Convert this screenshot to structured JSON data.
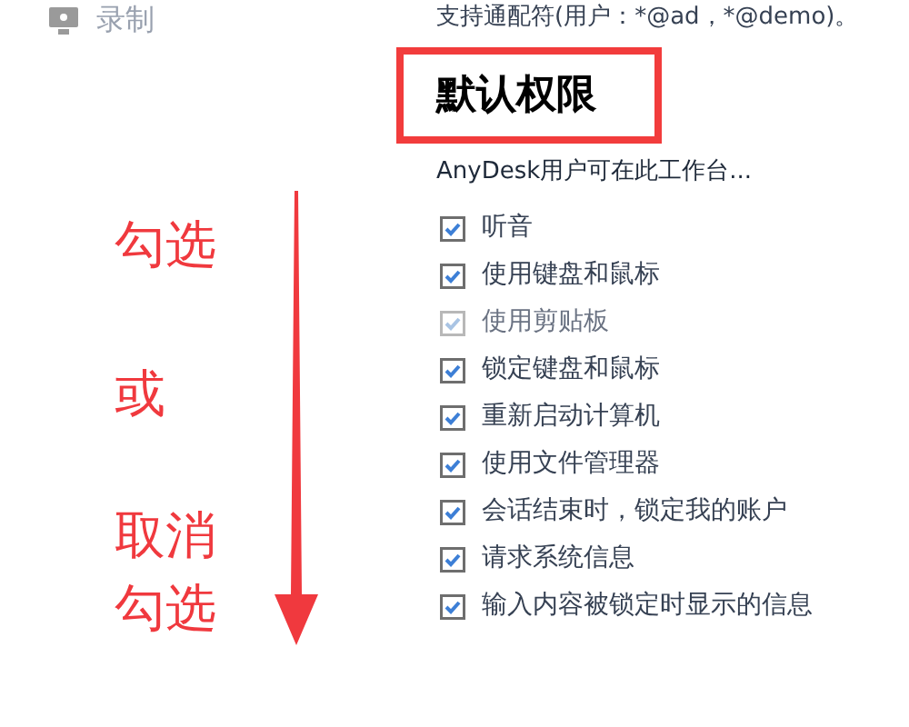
{
  "sidebar": {
    "items": [
      {
        "label": "录制"
      }
    ]
  },
  "top_note": "支持通配符(用户：*@ad，*@demo)。",
  "section": {
    "title": "默认权限",
    "subtitle": "AnyDesk用户可在此工作台...",
    "permissions": [
      {
        "label": "听音",
        "checked": true,
        "disabled": false
      },
      {
        "label": "使用键盘和鼠标",
        "checked": true,
        "disabled": false
      },
      {
        "label": "使用剪贴板",
        "checked": true,
        "disabled": true
      },
      {
        "label": "锁定键盘和鼠标",
        "checked": true,
        "disabled": false
      },
      {
        "label": "重新启动计算机",
        "checked": true,
        "disabled": false
      },
      {
        "label": "使用文件管理器",
        "checked": true,
        "disabled": false
      },
      {
        "label": "会话结束时，锁定我的账户",
        "checked": true,
        "disabled": false
      },
      {
        "label": "请求系统信息",
        "checked": true,
        "disabled": false
      },
      {
        "label": "输入内容被锁定时显示的信息",
        "checked": true,
        "disabled": false
      }
    ]
  },
  "annotation": {
    "lines": [
      "勾选",
      "或",
      "取消",
      "勾选"
    ]
  }
}
